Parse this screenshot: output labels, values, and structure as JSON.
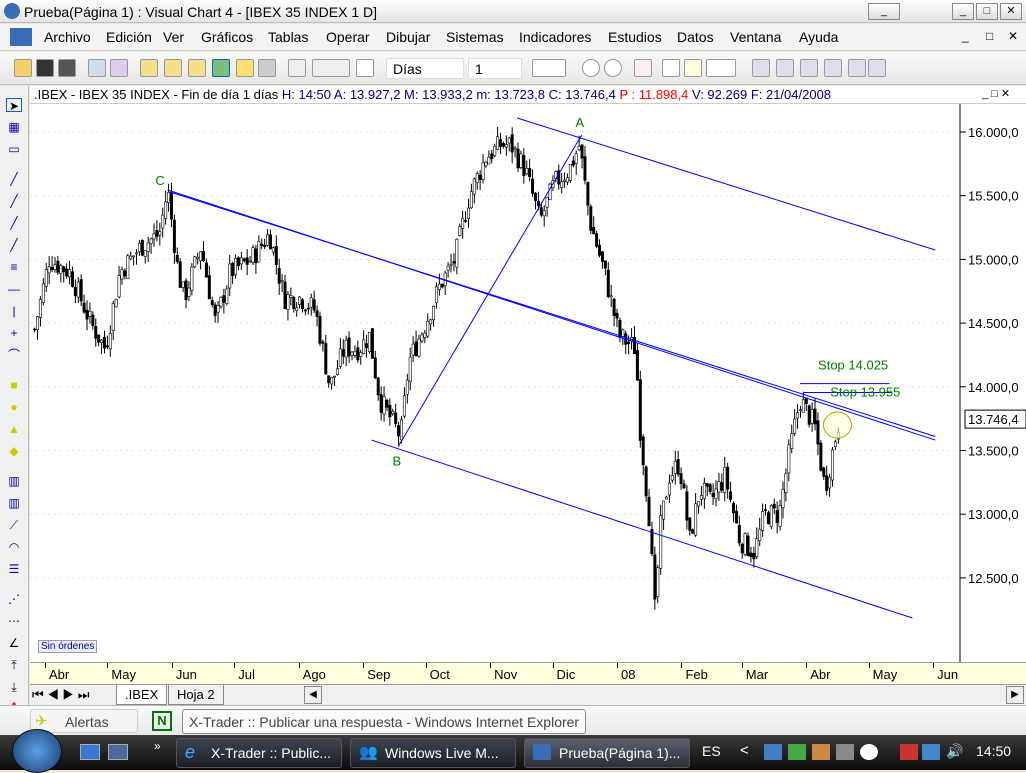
{
  "window": {
    "title": "Prueba(Página 1) : Visual Chart 4 - [IBEX 35 INDEX 1 D]",
    "min": "_",
    "max": "□",
    "close": "✕"
  },
  "menu": [
    "Archivo",
    "Edición",
    "Ver",
    "Gráficos",
    "Tablas",
    "Operar",
    "Dibujar",
    "Sistemas",
    "Indicadores",
    "Estudios",
    "Datos",
    "Ventana",
    "Ayuda"
  ],
  "toolbar": {
    "period": "Días",
    "multiplier": "1"
  },
  "info": {
    "symbol": ".IBEX - IBEX 35 INDEX - Fin de día 1 días",
    "h": "H: 14:50",
    "a": "A: 13.927,2",
    "m": "M: 13.933,2",
    "min": "m: 13.723,8",
    "c": "C: 13.746,4",
    "p": "P : 11.898,4",
    "v": "V: 92.269",
    "f": "F: 21/04/2008",
    "color_p": "#ff0000",
    "color_text": "#000080"
  },
  "chart_data": {
    "type": "candlestick",
    "title": "IBEX 35 INDEX",
    "x_unit": "days since 2007-04-01",
    "x_ticks": [
      {
        "d": 0,
        "label": "Abr"
      },
      {
        "d": 30,
        "label": "May"
      },
      {
        "d": 61,
        "label": "Jun"
      },
      {
        "d": 91,
        "label": "Jul"
      },
      {
        "d": 122,
        "label": "Ago"
      },
      {
        "d": 153,
        "label": "Sep"
      },
      {
        "d": 183,
        "label": "Oct"
      },
      {
        "d": 214,
        "label": "Nov"
      },
      {
        "d": 244,
        "label": "Dic"
      },
      {
        "d": 275,
        "label": "08"
      },
      {
        "d": 306,
        "label": "Feb"
      },
      {
        "d": 335,
        "label": "Mar"
      },
      {
        "d": 366,
        "label": "Abr"
      },
      {
        "d": 396,
        "label": "May"
      },
      {
        "d": 427,
        "label": "Jun"
      }
    ],
    "y_ticks": [
      {
        "v": 16000,
        "label": "16.000,0"
      },
      {
        "v": 15500,
        "label": "15.500,0"
      },
      {
        "v": 15000,
        "label": "15.000,0"
      },
      {
        "v": 14500,
        "label": "14.500,0"
      },
      {
        "v": 14000,
        "label": "14.000,0"
      },
      {
        "v": 13500,
        "label": "13.500,0"
      },
      {
        "v": 13000,
        "label": "13.000,0"
      },
      {
        "v": 12500,
        "label": "12.500,0"
      }
    ],
    "ylim": [
      12000,
      16300
    ],
    "xlim": [
      -7,
      445
    ],
    "close_path": [
      [
        -5,
        14450
      ],
      [
        2,
        15000
      ],
      [
        12,
        14900
      ],
      [
        22,
        14500
      ],
      [
        29,
        14300
      ],
      [
        36,
        14900
      ],
      [
        46,
        15100
      ],
      [
        55,
        15200
      ],
      [
        59,
        15550
      ],
      [
        64,
        14900
      ],
      [
        67,
        14700
      ],
      [
        75,
        15100
      ],
      [
        82,
        14500
      ],
      [
        89,
        14900
      ],
      [
        99,
        15000
      ],
      [
        108,
        15200
      ],
      [
        115,
        14700
      ],
      [
        123,
        14700
      ],
      [
        130,
        14600
      ],
      [
        137,
        14000
      ],
      [
        144,
        14300
      ],
      [
        151,
        14300
      ],
      [
        156,
        14400
      ],
      [
        161,
        13900
      ],
      [
        168,
        13700
      ],
      [
        171,
        13600
      ],
      [
        175,
        14200
      ],
      [
        183,
        14500
      ],
      [
        190,
        14800
      ],
      [
        197,
        15000
      ],
      [
        204,
        15500
      ],
      [
        212,
        15800
      ],
      [
        219,
        15900
      ],
      [
        224,
        15900
      ],
      [
        231,
        15700
      ],
      [
        238,
        15300
      ],
      [
        245,
        15600
      ],
      [
        252,
        15700
      ],
      [
        257,
        15900
      ],
      [
        262,
        15300
      ],
      [
        269,
        14900
      ],
      [
        276,
        14400
      ],
      [
        284,
        14300
      ],
      [
        286,
        13700
      ],
      [
        291,
        12900
      ],
      [
        293,
        12200
      ],
      [
        296,
        12900
      ],
      [
        300,
        13300
      ],
      [
        305,
        13400
      ],
      [
        310,
        12800
      ],
      [
        315,
        13200
      ],
      [
        320,
        13100
      ],
      [
        327,
        13300
      ],
      [
        334,
        12800
      ],
      [
        341,
        12700
      ],
      [
        346,
        13000
      ],
      [
        353,
        13000
      ],
      [
        358,
        13500
      ],
      [
        363,
        13900
      ],
      [
        370,
        13700
      ],
      [
        375,
        13200
      ],
      [
        380,
        13600
      ],
      [
        382,
        13750
      ]
    ],
    "trendlines": [
      {
        "name": "upper-channel",
        "from": [
          227,
          16110
        ],
        "to": [
          428,
          15074
        ]
      },
      {
        "name": "resistance-line",
        "from": [
          59,
          15545
        ],
        "to": [
          428,
          13582
        ]
      },
      {
        "name": "resistance-line-2",
        "from": [
          60,
          15530
        ],
        "to": [
          428,
          13610
        ]
      },
      {
        "name": "lower-channel",
        "from": [
          157,
          13582
        ],
        "to": [
          417,
          12185
        ]
      },
      {
        "name": "b-a-line",
        "from": [
          170,
          13535
        ],
        "to": [
          258,
          15976
        ]
      }
    ],
    "stops": [
      {
        "label": "Stop 14.025",
        "value": 14025,
        "from": 363,
        "to": 406
      },
      {
        "label": "Stop 13.955",
        "value": 13955,
        "from": 365,
        "to": 407
      }
    ],
    "points": [
      {
        "label": "A",
        "d": 257,
        "v": 16080
      },
      {
        "label": "B",
        "d": 169,
        "v": 13420
      },
      {
        "label": "C",
        "d": 55,
        "v": 15625
      }
    ],
    "last_price": "13.746,4",
    "last_value": 13746.4,
    "line_color": "#0000ff",
    "label_color": "#008000"
  },
  "orders": "Sin órdenes",
  "tabs": [
    ".IBEX",
    "Hoja 2"
  ],
  "status": {
    "alerts": "Alertas",
    "tooltip": "X-Trader :: Publicar una respuesta - Windows Internet Explorer",
    "n": "N"
  },
  "taskbar": {
    "items": [
      "X-Trader :: Public...",
      "Windows Live M...",
      "Prueba(Página 1)..."
    ],
    "lang": "ES",
    "clock": "14:50",
    "chevron": "»",
    "back": "<"
  }
}
